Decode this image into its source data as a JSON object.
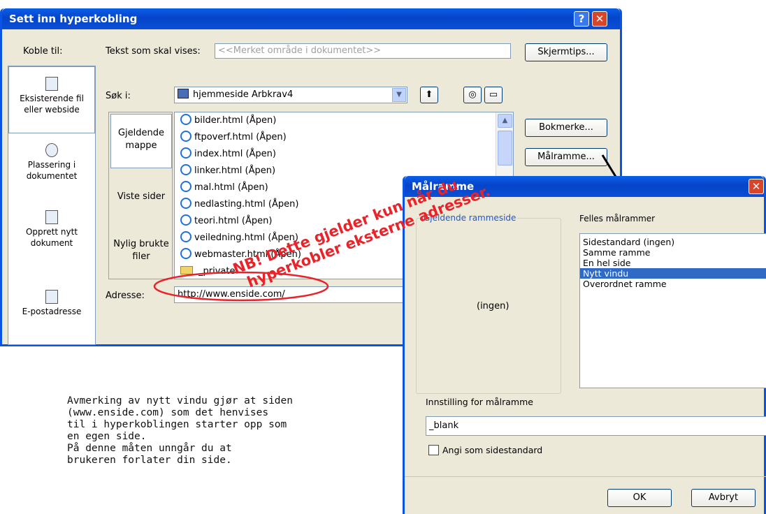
{
  "main_dialog": {
    "title": "Sett inn hyperkobling",
    "help_glyph": "?",
    "close_glyph": "✕",
    "koble_til_label": "Koble til:",
    "tekst_label": "Tekst som skal vises:",
    "tekst_value": "<<Merket område i dokumentet>>",
    "skjermtips_button": "Skjermtips...",
    "sok_label": "Søk i:",
    "sok_value": "hjemmeside Arbkrav4",
    "bokmerke_button": "Bokmerke...",
    "malramme_button": "Målramme...",
    "adresse_label": "Adresse:",
    "adresse_value": "http://www.enside.com/",
    "link_bar": [
      {
        "line1": "Eksisterende fil",
        "line2": "eller webside",
        "icon": "existing-file-icon"
      },
      {
        "line1": "Plassering i",
        "line2": "dokumentet",
        "icon": "place-in-document-icon"
      },
      {
        "line1": "Opprett nytt",
        "line2": "dokument",
        "icon": "new-document-icon"
      },
      {
        "line1": "E-postadresse",
        "line2": "",
        "icon": "email-icon"
      }
    ],
    "inner_nav": [
      {
        "line1": "Gjeldende",
        "line2": "mappe"
      },
      {
        "line1": "Viste sider",
        "line2": ""
      },
      {
        "line1": "Nylig brukte",
        "line2": "filer"
      }
    ],
    "files": [
      "bilder.html (Åpen)",
      "ftpoverf.html (Åpen)",
      "index.html (Åpen)",
      "linker.html (Åpen)",
      "mal.html (Åpen)",
      "nedlasting.html (Åpen)",
      "teori.html (Åpen)",
      "veiledning.html (Åpen)",
      "webmaster.html (Åpen)",
      "_private"
    ]
  },
  "target_dialog": {
    "title": "Målramme",
    "close_glyph": "✕",
    "gjeldende_label": "Gjeldende rammeside",
    "ingen_text": "(ingen)",
    "felles_label": "Felles målrammer",
    "frames": [
      "Sidestandard (ingen)",
      "Samme ramme",
      "En hel side",
      "Nytt vindu",
      "Overordnet ramme"
    ],
    "selected_index": 3,
    "innstilling_label": "Innstilling for målramme",
    "innstilling_value": "_blank",
    "checkbox_label": "Angi som sidestandard",
    "checkbox_checked": false,
    "ok_button": "OK",
    "avbryt_button": "Avbryt"
  },
  "annotation": {
    "line1": "NB! Dette gjelder kun når du",
    "line2": "hyperkobler eksterne adresser.",
    "color": "#e8242a"
  },
  "note_lines": [
    "Avmerking av nytt vindu gjør at siden",
    "(www.enside.com) som det henvises",
    "til i hyperkoblingen starter  opp som",
    "en egen side.",
    "På denne måten unngår du at",
    "brukeren forlater din side."
  ],
  "colors": {
    "titlebar": "#0544c9",
    "dialog_bg": "#ece9d8",
    "selection": "#316ac5",
    "annotation_red": "#e8242a"
  }
}
